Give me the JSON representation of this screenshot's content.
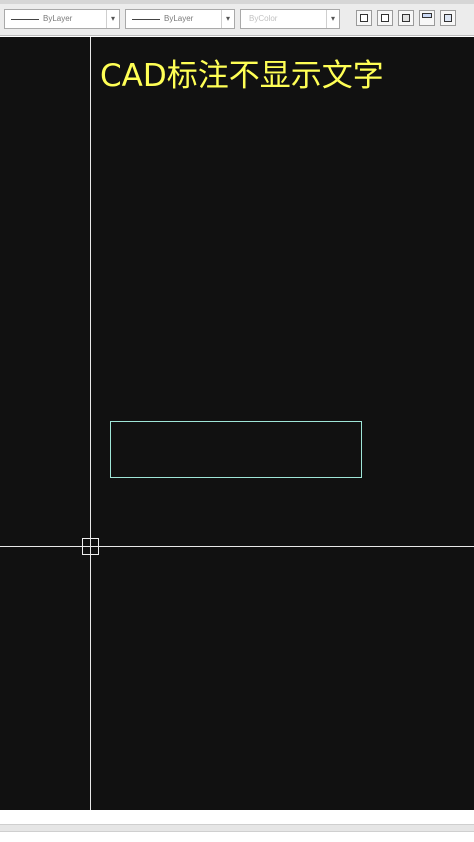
{
  "toolbar": {
    "linetype_value": "ByLayer",
    "lineweight_value": "ByLayer",
    "plotstyle_value": "ByColor",
    "buttons": [
      "viewport-icon",
      "window-icon",
      "clip-icon",
      "layout-icon",
      "grid-icon"
    ]
  },
  "canvas": {
    "annotation_text": "CAD标注不显示文字",
    "background_color": "#111111",
    "annotation_color": "#ffff55",
    "rectangle_color": "#9fe6d8"
  }
}
